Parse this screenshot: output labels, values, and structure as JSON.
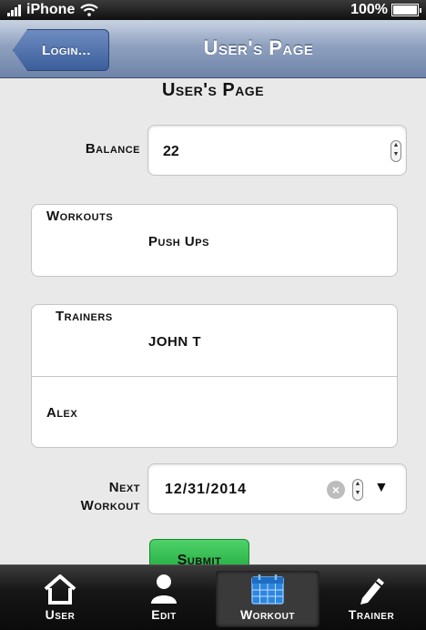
{
  "status_bar": {
    "carrier": "iPhone",
    "battery": "100%"
  },
  "header": {
    "back_label": "Login...",
    "title": "User's Page"
  },
  "main": {
    "heading": "User's Page",
    "balance": {
      "label": "Balance",
      "value": "22"
    },
    "workouts": {
      "label": "Workouts",
      "items": [
        "Push Ups"
      ]
    },
    "trainers": {
      "label": "Trainers",
      "items": [
        "JOHN T",
        "Alex"
      ]
    },
    "next_workout": {
      "label_line1": "Next",
      "label_line2": "Workout",
      "value": "12/31/2014"
    },
    "submit_label": "Submit"
  },
  "tabbar": {
    "tabs": [
      {
        "label": "User",
        "icon": "home-icon"
      },
      {
        "label": "Edit",
        "icon": "person-icon"
      },
      {
        "label": "Workout",
        "icon": "calendar-icon",
        "active": true
      },
      {
        "label": "Trainer",
        "icon": "pencil-icon"
      }
    ]
  },
  "colors": {
    "header": "#7f93b6",
    "back_button": "#4b6ca6",
    "submit": "#28b646",
    "tabbar": "#111111"
  }
}
